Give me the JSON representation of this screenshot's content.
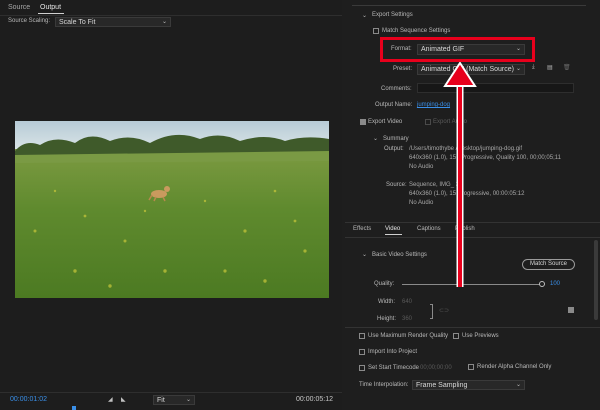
{
  "colors": {
    "accent": "#3a8fe8",
    "annotation": "#e8001c",
    "panel": "#1e1e1e"
  },
  "monitor": {
    "tabs": [
      "Source",
      "Output"
    ],
    "active_tab": "Output",
    "source_scaling_label": "Source Scaling:",
    "source_scaling_value": "Scale To Fit",
    "current_time": "00:00:01:02",
    "duration": "00:00:05:12",
    "fit_value": "Fit"
  },
  "export_settings": {
    "section_title": "Export Settings",
    "match_sequence_label": "Match Sequence Settings",
    "format_label": "Format:",
    "format_value": "Animated GIF",
    "preset_label": "Preset:",
    "preset_value": "Animated GIF (Match Source)",
    "comments_label": "Comments:",
    "output_name_label": "Output Name:",
    "output_name_value": "jumping-dog",
    "export_video_label": "Export Video",
    "export_audio_label": "Export Audio",
    "summary_title": "Summary",
    "output_label": "Output:",
    "output_lines": [
      "/Users/timothybe     /Desktop/jumping-dog.gif",
      "640x360 (1.0), 15      , Progressive, Quality 100, 00;00;05;11",
      "No Audio"
    ],
    "source_label": "Source:",
    "source_lines": [
      "Sequence, IMG_        3",
      "640x360 (1.0), 15      Progressive, 00:00:05:12",
      "No Audio"
    ]
  },
  "settings_tabs": [
    "Effects",
    "Video",
    "Captions",
    "Publish"
  ],
  "active_settings_tab": "Video",
  "basic_video": {
    "section_title": "Basic Video Settings",
    "match_source_button": "Match Source",
    "quality_label": "Quality:",
    "quality_value": "100",
    "width_label": "Width:",
    "width_value": "640",
    "height_label": "Height:",
    "height_value": "360"
  },
  "bottom_options": {
    "max_render_quality": "Use Maximum Render Quality",
    "use_previews": "Use Previews",
    "import_into_project": "Import Into Project",
    "set_start_timecode": "Set Start Timecode",
    "start_timecode_value": "00;00;00;00",
    "render_alpha": "Render Alpha Channel Only",
    "time_interpolation_label": "Time Interpolation:",
    "time_interpolation_value": "Frame Sampling"
  }
}
